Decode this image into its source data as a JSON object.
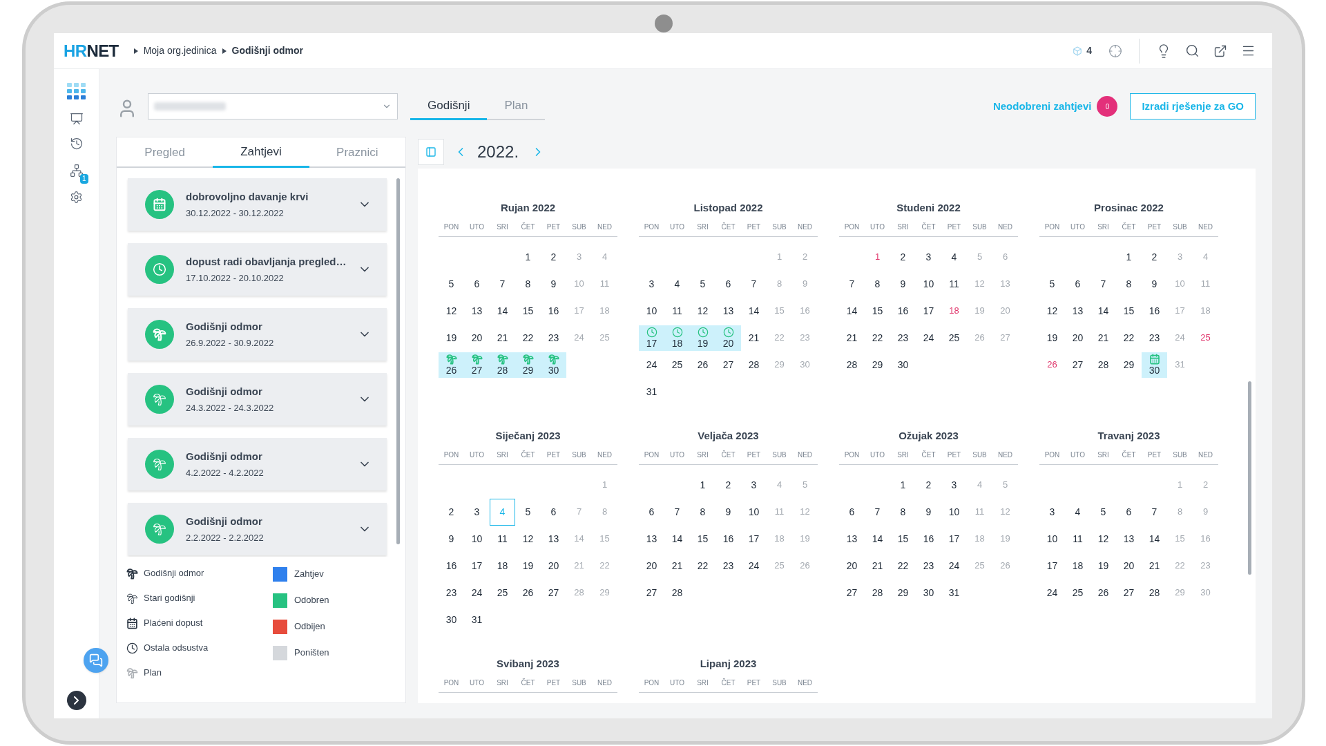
{
  "topbar": {
    "logo": [
      "HR",
      "NET"
    ],
    "breadcrumbs": [
      {
        "label": "Moja org.jedinica",
        "current": false
      },
      {
        "label": "Godišnji odmor",
        "current": true
      }
    ],
    "counter": "4"
  },
  "rail": [
    {
      "kind": "apps"
    },
    {
      "kind": "presentation"
    },
    {
      "kind": "history"
    },
    {
      "kind": "network",
      "badge": "1"
    },
    {
      "kind": "settings"
    }
  ],
  "view_tabs": [
    {
      "label": "Godišnji",
      "selected": true
    },
    {
      "label": "Plan",
      "selected": false
    }
  ],
  "unapproved": {
    "label": "Neodobreni zahtjevi",
    "count": "0"
  },
  "create_button": "Izradi rješenje za GO",
  "panel_tabs": [
    {
      "label": "Pregled",
      "selected": false
    },
    {
      "label": "Zahtjevi",
      "selected": true
    },
    {
      "label": "Praznici",
      "selected": false
    }
  ],
  "requests": [
    {
      "title": "dobrovoljno davanje krvi",
      "dates": "30.12.2022 - 30.12.2022",
      "kind": "calendar"
    },
    {
      "title": "dopust radi obavljanja pregled…",
      "dates": "17.10.2022 - 20.10.2022",
      "kind": "clock"
    },
    {
      "title": "Godišnji odmor",
      "dates": "26.9.2022 - 30.9.2022",
      "kind": "vacation"
    },
    {
      "title": "Godišnji odmor",
      "dates": "24.3.2022 - 24.3.2022",
      "kind": "old"
    },
    {
      "title": "Godišnji odmor",
      "dates": "4.2.2022 - 4.2.2022",
      "kind": "old"
    },
    {
      "title": "Godišnji odmor",
      "dates": "2.2.2022 - 2.2.2022",
      "kind": "old"
    }
  ],
  "legend": {
    "types": [
      {
        "label": "Godišnji odmor",
        "kind": "vacation"
      },
      {
        "label": "Stari godišnji",
        "kind": "old"
      },
      {
        "label": "Plaćeni dopust",
        "kind": "calendar"
      },
      {
        "label": "Ostala odsustva",
        "kind": "clock"
      },
      {
        "label": "Plan",
        "kind": "plan"
      }
    ],
    "statuses": [
      {
        "label": "Zahtjev",
        "color": "#2f80ed"
      },
      {
        "label": "Odobren",
        "color": "#26c281"
      },
      {
        "label": "Odbijen",
        "color": "#e74c3c"
      },
      {
        "label": "Poništen",
        "color": "#d5d8dc"
      }
    ]
  },
  "year": "2022.",
  "months": [
    {
      "title": "Rujan 2022",
      "weekdays": [
        "PON",
        "UTO",
        "SRI",
        "ČET",
        "PET",
        "SUB",
        "NED"
      ],
      "weeks": [
        [
          {
            "kind": "blank"
          },
          {
            "kind": "blank"
          },
          {
            "kind": "blank"
          },
          {
            "day": "1",
            "kind": "work"
          },
          {
            "day": "2",
            "kind": "work"
          },
          {
            "day": "3",
            "kind": "weekend"
          },
          {
            "day": "4",
            "kind": "weekend"
          }
        ],
        [
          {
            "day": "5",
            "kind": "work"
          },
          {
            "day": "6",
            "kind": "work"
          },
          {
            "day": "7",
            "kind": "work"
          },
          {
            "day": "8",
            "kind": "work"
          },
          {
            "day": "9",
            "kind": "work"
          },
          {
            "day": "10",
            "kind": "weekend"
          },
          {
            "day": "11",
            "kind": "weekend"
          }
        ],
        [
          {
            "day": "12",
            "kind": "work"
          },
          {
            "day": "13",
            "kind": "work"
          },
          {
            "day": "14",
            "kind": "work"
          },
          {
            "day": "15",
            "kind": "work"
          },
          {
            "day": "16",
            "kind": "work"
          },
          {
            "day": "17",
            "kind": "weekend"
          },
          {
            "day": "18",
            "kind": "weekend"
          }
        ],
        [
          {
            "day": "19",
            "kind": "work"
          },
          {
            "day": "20",
            "kind": "work"
          },
          {
            "day": "21",
            "kind": "work"
          },
          {
            "day": "22",
            "kind": "work"
          },
          {
            "day": "23",
            "kind": "work"
          },
          {
            "day": "24",
            "kind": "weekend"
          },
          {
            "day": "25",
            "kind": "weekend"
          }
        ],
        [
          {
            "day": "26",
            "kind": "vacation"
          },
          {
            "day": "27",
            "kind": "vacation"
          },
          {
            "day": "28",
            "kind": "vacation"
          },
          {
            "day": "29",
            "kind": "vacation"
          },
          {
            "day": "30",
            "kind": "vacation"
          }
        ]
      ]
    },
    {
      "title": "Listopad 2022",
      "weekdays": [
        "PON",
        "UTO",
        "SRI",
        "ČET",
        "PET",
        "SUB",
        "NED"
      ],
      "weeks": [
        [
          {
            "kind": "blank"
          },
          {
            "kind": "blank"
          },
          {
            "kind": "blank"
          },
          {
            "kind": "blank"
          },
          {
            "kind": "blank"
          },
          {
            "day": "1",
            "kind": "weekend"
          },
          {
            "day": "2",
            "kind": "weekend"
          }
        ],
        [
          {
            "day": "3",
            "kind": "work"
          },
          {
            "day": "4",
            "kind": "work"
          },
          {
            "day": "5",
            "kind": "work"
          },
          {
            "day": "6",
            "kind": "work"
          },
          {
            "day": "7",
            "kind": "work"
          },
          {
            "day": "8",
            "kind": "weekend"
          },
          {
            "day": "9",
            "kind": "weekend"
          }
        ],
        [
          {
            "day": "10",
            "kind": "work"
          },
          {
            "day": "11",
            "kind": "work"
          },
          {
            "day": "12",
            "kind": "work"
          },
          {
            "day": "13",
            "kind": "work"
          },
          {
            "day": "14",
            "kind": "work"
          },
          {
            "day": "15",
            "kind": "weekend"
          },
          {
            "day": "16",
            "kind": "weekend"
          }
        ],
        [
          {
            "day": "17",
            "kind": "other_leave"
          },
          {
            "day": "18",
            "kind": "other_leave"
          },
          {
            "day": "19",
            "kind": "other_leave"
          },
          {
            "day": "20",
            "kind": "other_leave"
          },
          {
            "day": "21",
            "kind": "work"
          },
          {
            "day": "22",
            "kind": "weekend"
          },
          {
            "day": "23",
            "kind": "weekend"
          }
        ],
        [
          {
            "day": "24",
            "kind": "work"
          },
          {
            "day": "25",
            "kind": "work"
          },
          {
            "day": "26",
            "kind": "work"
          },
          {
            "day": "27",
            "kind": "work"
          },
          {
            "day": "28",
            "kind": "work"
          },
          {
            "day": "29",
            "kind": "weekend"
          },
          {
            "day": "30",
            "kind": "weekend"
          }
        ],
        [
          {
            "day": "31",
            "kind": "work"
          }
        ]
      ]
    },
    {
      "title": "Studeni 2022",
      "weekdays": [
        "PON",
        "UTO",
        "SRI",
        "ČET",
        "PET",
        "SUB",
        "NED"
      ],
      "weeks": [
        [
          {
            "kind": "blank"
          },
          {
            "day": "1",
            "kind": "holiday"
          },
          {
            "day": "2",
            "kind": "work"
          },
          {
            "day": "3",
            "kind": "work"
          },
          {
            "day": "4",
            "kind": "work"
          },
          {
            "day": "5",
            "kind": "weekend"
          },
          {
            "day": "6",
            "kind": "weekend"
          }
        ],
        [
          {
            "day": "7",
            "kind": "work"
          },
          {
            "day": "8",
            "kind": "work"
          },
          {
            "day": "9",
            "kind": "work"
          },
          {
            "day": "10",
            "kind": "work"
          },
          {
            "day": "11",
            "kind": "work"
          },
          {
            "day": "12",
            "kind": "weekend"
          },
          {
            "day": "13",
            "kind": "weekend"
          }
        ],
        [
          {
            "day": "14",
            "kind": "work"
          },
          {
            "day": "15",
            "kind": "work"
          },
          {
            "day": "16",
            "kind": "work"
          },
          {
            "day": "17",
            "kind": "work"
          },
          {
            "day": "18",
            "kind": "holiday"
          },
          {
            "day": "19",
            "kind": "weekend"
          },
          {
            "day": "20",
            "kind": "weekend"
          }
        ],
        [
          {
            "day": "21",
            "kind": "work"
          },
          {
            "day": "22",
            "kind": "work"
          },
          {
            "day": "23",
            "kind": "work"
          },
          {
            "day": "24",
            "kind": "work"
          },
          {
            "day": "25",
            "kind": "work"
          },
          {
            "day": "26",
            "kind": "weekend"
          },
          {
            "day": "27",
            "kind": "weekend"
          }
        ],
        [
          {
            "day": "28",
            "kind": "work"
          },
          {
            "day": "29",
            "kind": "work"
          },
          {
            "day": "30",
            "kind": "work"
          }
        ]
      ]
    },
    {
      "title": "Prosinac 2022",
      "weekdays": [
        "PON",
        "UTO",
        "SRI",
        "ČET",
        "PET",
        "SUB",
        "NED"
      ],
      "weeks": [
        [
          {
            "kind": "blank"
          },
          {
            "kind": "blank"
          },
          {
            "kind": "blank"
          },
          {
            "day": "1",
            "kind": "work"
          },
          {
            "day": "2",
            "kind": "work"
          },
          {
            "day": "3",
            "kind": "weekend"
          },
          {
            "day": "4",
            "kind": "weekend"
          }
        ],
        [
          {
            "day": "5",
            "kind": "work"
          },
          {
            "day": "6",
            "kind": "work"
          },
          {
            "day": "7",
            "kind": "work"
          },
          {
            "day": "8",
            "kind": "work"
          },
          {
            "day": "9",
            "kind": "work"
          },
          {
            "day": "10",
            "kind": "weekend"
          },
          {
            "day": "11",
            "kind": "weekend"
          }
        ],
        [
          {
            "day": "12",
            "kind": "work"
          },
          {
            "day": "13",
            "kind": "work"
          },
          {
            "day": "14",
            "kind": "work"
          },
          {
            "day": "15",
            "kind": "work"
          },
          {
            "day": "16",
            "kind": "work"
          },
          {
            "day": "17",
            "kind": "weekend"
          },
          {
            "day": "18",
            "kind": "weekend"
          }
        ],
        [
          {
            "day": "19",
            "kind": "work"
          },
          {
            "day": "20",
            "kind": "work"
          },
          {
            "day": "21",
            "kind": "work"
          },
          {
            "day": "22",
            "kind": "work"
          },
          {
            "day": "23",
            "kind": "work"
          },
          {
            "day": "24",
            "kind": "weekend"
          },
          {
            "day": "25",
            "kind": "holiday"
          }
        ],
        [
          {
            "day": "26",
            "kind": "holiday"
          },
          {
            "day": "27",
            "kind": "work"
          },
          {
            "day": "28",
            "kind": "work"
          },
          {
            "day": "29",
            "kind": "work"
          },
          {
            "day": "30",
            "kind": "paid_leave"
          },
          {
            "day": "31",
            "kind": "weekend"
          }
        ]
      ]
    },
    {
      "title": "Siječanj 2023",
      "weekdays": [
        "PON",
        "UTO",
        "SRI",
        "ČET",
        "PET",
        "SUB",
        "NED"
      ],
      "weeks": [
        [
          {
            "kind": "blank"
          },
          {
            "kind": "blank"
          },
          {
            "kind": "blank"
          },
          {
            "kind": "blank"
          },
          {
            "kind": "blank"
          },
          {
            "kind": "blank"
          },
          {
            "day": "1",
            "kind": "weekend"
          }
        ],
        [
          {
            "day": "2",
            "kind": "work"
          },
          {
            "day": "3",
            "kind": "work"
          },
          {
            "day": "4",
            "kind": "today"
          },
          {
            "day": "5",
            "kind": "work"
          },
          {
            "day": "6",
            "kind": "work"
          },
          {
            "day": "7",
            "kind": "weekend"
          },
          {
            "day": "8",
            "kind": "weekend"
          }
        ],
        [
          {
            "day": "9",
            "kind": "work"
          },
          {
            "day": "10",
            "kind": "work"
          },
          {
            "day": "11",
            "kind": "work"
          },
          {
            "day": "12",
            "kind": "work"
          },
          {
            "day": "13",
            "kind": "work"
          },
          {
            "day": "14",
            "kind": "weekend"
          },
          {
            "day": "15",
            "kind": "weekend"
          }
        ],
        [
          {
            "day": "16",
            "kind": "work"
          },
          {
            "day": "17",
            "kind": "work"
          },
          {
            "day": "18",
            "kind": "work"
          },
          {
            "day": "19",
            "kind": "work"
          },
          {
            "day": "20",
            "kind": "work"
          },
          {
            "day": "21",
            "kind": "weekend"
          },
          {
            "day": "22",
            "kind": "weekend"
          }
        ],
        [
          {
            "day": "23",
            "kind": "work"
          },
          {
            "day": "24",
            "kind": "work"
          },
          {
            "day": "25",
            "kind": "work"
          },
          {
            "day": "26",
            "kind": "work"
          },
          {
            "day": "27",
            "kind": "work"
          },
          {
            "day": "28",
            "kind": "weekend"
          },
          {
            "day": "29",
            "kind": "weekend"
          }
        ],
        [
          {
            "day": "30",
            "kind": "work"
          },
          {
            "day": "31",
            "kind": "work"
          }
        ]
      ]
    },
    {
      "title": "Veljača 2023",
      "weekdays": [
        "PON",
        "UTO",
        "SRI",
        "ČET",
        "PET",
        "SUB",
        "NED"
      ],
      "weeks": [
        [
          {
            "kind": "blank"
          },
          {
            "kind": "blank"
          },
          {
            "day": "1",
            "kind": "work"
          },
          {
            "day": "2",
            "kind": "work"
          },
          {
            "day": "3",
            "kind": "work"
          },
          {
            "day": "4",
            "kind": "weekend"
          },
          {
            "day": "5",
            "kind": "weekend"
          }
        ],
        [
          {
            "day": "6",
            "kind": "work"
          },
          {
            "day": "7",
            "kind": "work"
          },
          {
            "day": "8",
            "kind": "work"
          },
          {
            "day": "9",
            "kind": "work"
          },
          {
            "day": "10",
            "kind": "work"
          },
          {
            "day": "11",
            "kind": "weekend"
          },
          {
            "day": "12",
            "kind": "weekend"
          }
        ],
        [
          {
            "day": "13",
            "kind": "work"
          },
          {
            "day": "14",
            "kind": "work"
          },
          {
            "day": "15",
            "kind": "work"
          },
          {
            "day": "16",
            "kind": "work"
          },
          {
            "day": "17",
            "kind": "work"
          },
          {
            "day": "18",
            "kind": "weekend"
          },
          {
            "day": "19",
            "kind": "weekend"
          }
        ],
        [
          {
            "day": "20",
            "kind": "work"
          },
          {
            "day": "21",
            "kind": "work"
          },
          {
            "day": "22",
            "kind": "work"
          },
          {
            "day": "23",
            "kind": "work"
          },
          {
            "day": "24",
            "kind": "work"
          },
          {
            "day": "25",
            "kind": "weekend"
          },
          {
            "day": "26",
            "kind": "weekend"
          }
        ],
        [
          {
            "day": "27",
            "kind": "work"
          },
          {
            "day": "28",
            "kind": "work"
          }
        ]
      ]
    },
    {
      "title": "Ožujak 2023",
      "weekdays": [
        "PON",
        "UTO",
        "SRI",
        "ČET",
        "PET",
        "SUB",
        "NED"
      ],
      "weeks": [
        [
          {
            "kind": "blank"
          },
          {
            "kind": "blank"
          },
          {
            "day": "1",
            "kind": "work"
          },
          {
            "day": "2",
            "kind": "work"
          },
          {
            "day": "3",
            "kind": "work"
          },
          {
            "day": "4",
            "kind": "weekend"
          },
          {
            "day": "5",
            "kind": "weekend"
          }
        ],
        [
          {
            "day": "6",
            "kind": "work"
          },
          {
            "day": "7",
            "kind": "work"
          },
          {
            "day": "8",
            "kind": "work"
          },
          {
            "day": "9",
            "kind": "work"
          },
          {
            "day": "10",
            "kind": "work"
          },
          {
            "day": "11",
            "kind": "weekend"
          },
          {
            "day": "12",
            "kind": "weekend"
          }
        ],
        [
          {
            "day": "13",
            "kind": "work"
          },
          {
            "day": "14",
            "kind": "work"
          },
          {
            "day": "15",
            "kind": "work"
          },
          {
            "day": "16",
            "kind": "work"
          },
          {
            "day": "17",
            "kind": "work"
          },
          {
            "day": "18",
            "kind": "weekend"
          },
          {
            "day": "19",
            "kind": "weekend"
          }
        ],
        [
          {
            "day": "20",
            "kind": "work"
          },
          {
            "day": "21",
            "kind": "work"
          },
          {
            "day": "22",
            "kind": "work"
          },
          {
            "day": "23",
            "kind": "work"
          },
          {
            "day": "24",
            "kind": "work"
          },
          {
            "day": "25",
            "kind": "weekend"
          },
          {
            "day": "26",
            "kind": "weekend"
          }
        ],
        [
          {
            "day": "27",
            "kind": "work"
          },
          {
            "day": "28",
            "kind": "work"
          },
          {
            "day": "29",
            "kind": "work"
          },
          {
            "day": "30",
            "kind": "work"
          },
          {
            "day": "31",
            "kind": "work"
          }
        ]
      ]
    },
    {
      "title": "Travanj 2023",
      "weekdays": [
        "PON",
        "UTO",
        "SRI",
        "ČET",
        "PET",
        "SUB",
        "NED"
      ],
      "weeks": [
        [
          {
            "kind": "blank"
          },
          {
            "kind": "blank"
          },
          {
            "kind": "blank"
          },
          {
            "kind": "blank"
          },
          {
            "kind": "blank"
          },
          {
            "day": "1",
            "kind": "weekend"
          },
          {
            "day": "2",
            "kind": "weekend"
          }
        ],
        [
          {
            "day": "3",
            "kind": "work"
          },
          {
            "day": "4",
            "kind": "work"
          },
          {
            "day": "5",
            "kind": "work"
          },
          {
            "day": "6",
            "kind": "work"
          },
          {
            "day": "7",
            "kind": "work"
          },
          {
            "day": "8",
            "kind": "weekend"
          },
          {
            "day": "9",
            "kind": "weekend"
          }
        ],
        [
          {
            "day": "10",
            "kind": "work"
          },
          {
            "day": "11",
            "kind": "work"
          },
          {
            "day": "12",
            "kind": "work"
          },
          {
            "day": "13",
            "kind": "work"
          },
          {
            "day": "14",
            "kind": "work"
          },
          {
            "day": "15",
            "kind": "weekend"
          },
          {
            "day": "16",
            "kind": "weekend"
          }
        ],
        [
          {
            "day": "17",
            "kind": "work"
          },
          {
            "day": "18",
            "kind": "work"
          },
          {
            "day": "19",
            "kind": "work"
          },
          {
            "day": "20",
            "kind": "work"
          },
          {
            "day": "21",
            "kind": "work"
          },
          {
            "day": "22",
            "kind": "weekend"
          },
          {
            "day": "23",
            "kind": "weekend"
          }
        ],
        [
          {
            "day": "24",
            "kind": "work"
          },
          {
            "day": "25",
            "kind": "work"
          },
          {
            "day": "26",
            "kind": "work"
          },
          {
            "day": "27",
            "kind": "work"
          },
          {
            "day": "28",
            "kind": "work"
          },
          {
            "day": "29",
            "kind": "weekend"
          },
          {
            "day": "30",
            "kind": "weekend"
          }
        ]
      ]
    },
    {
      "title": "Svibanj 2023",
      "weekdays": [
        "PON",
        "UTO",
        "SRI",
        "ČET",
        "PET",
        "SUB",
        "NED"
      ]
    },
    {
      "title": "Lipanj 2023",
      "weekdays": [
        "PON",
        "UTO",
        "SRI",
        "ČET",
        "PET",
        "SUB",
        "NED"
      ]
    }
  ]
}
